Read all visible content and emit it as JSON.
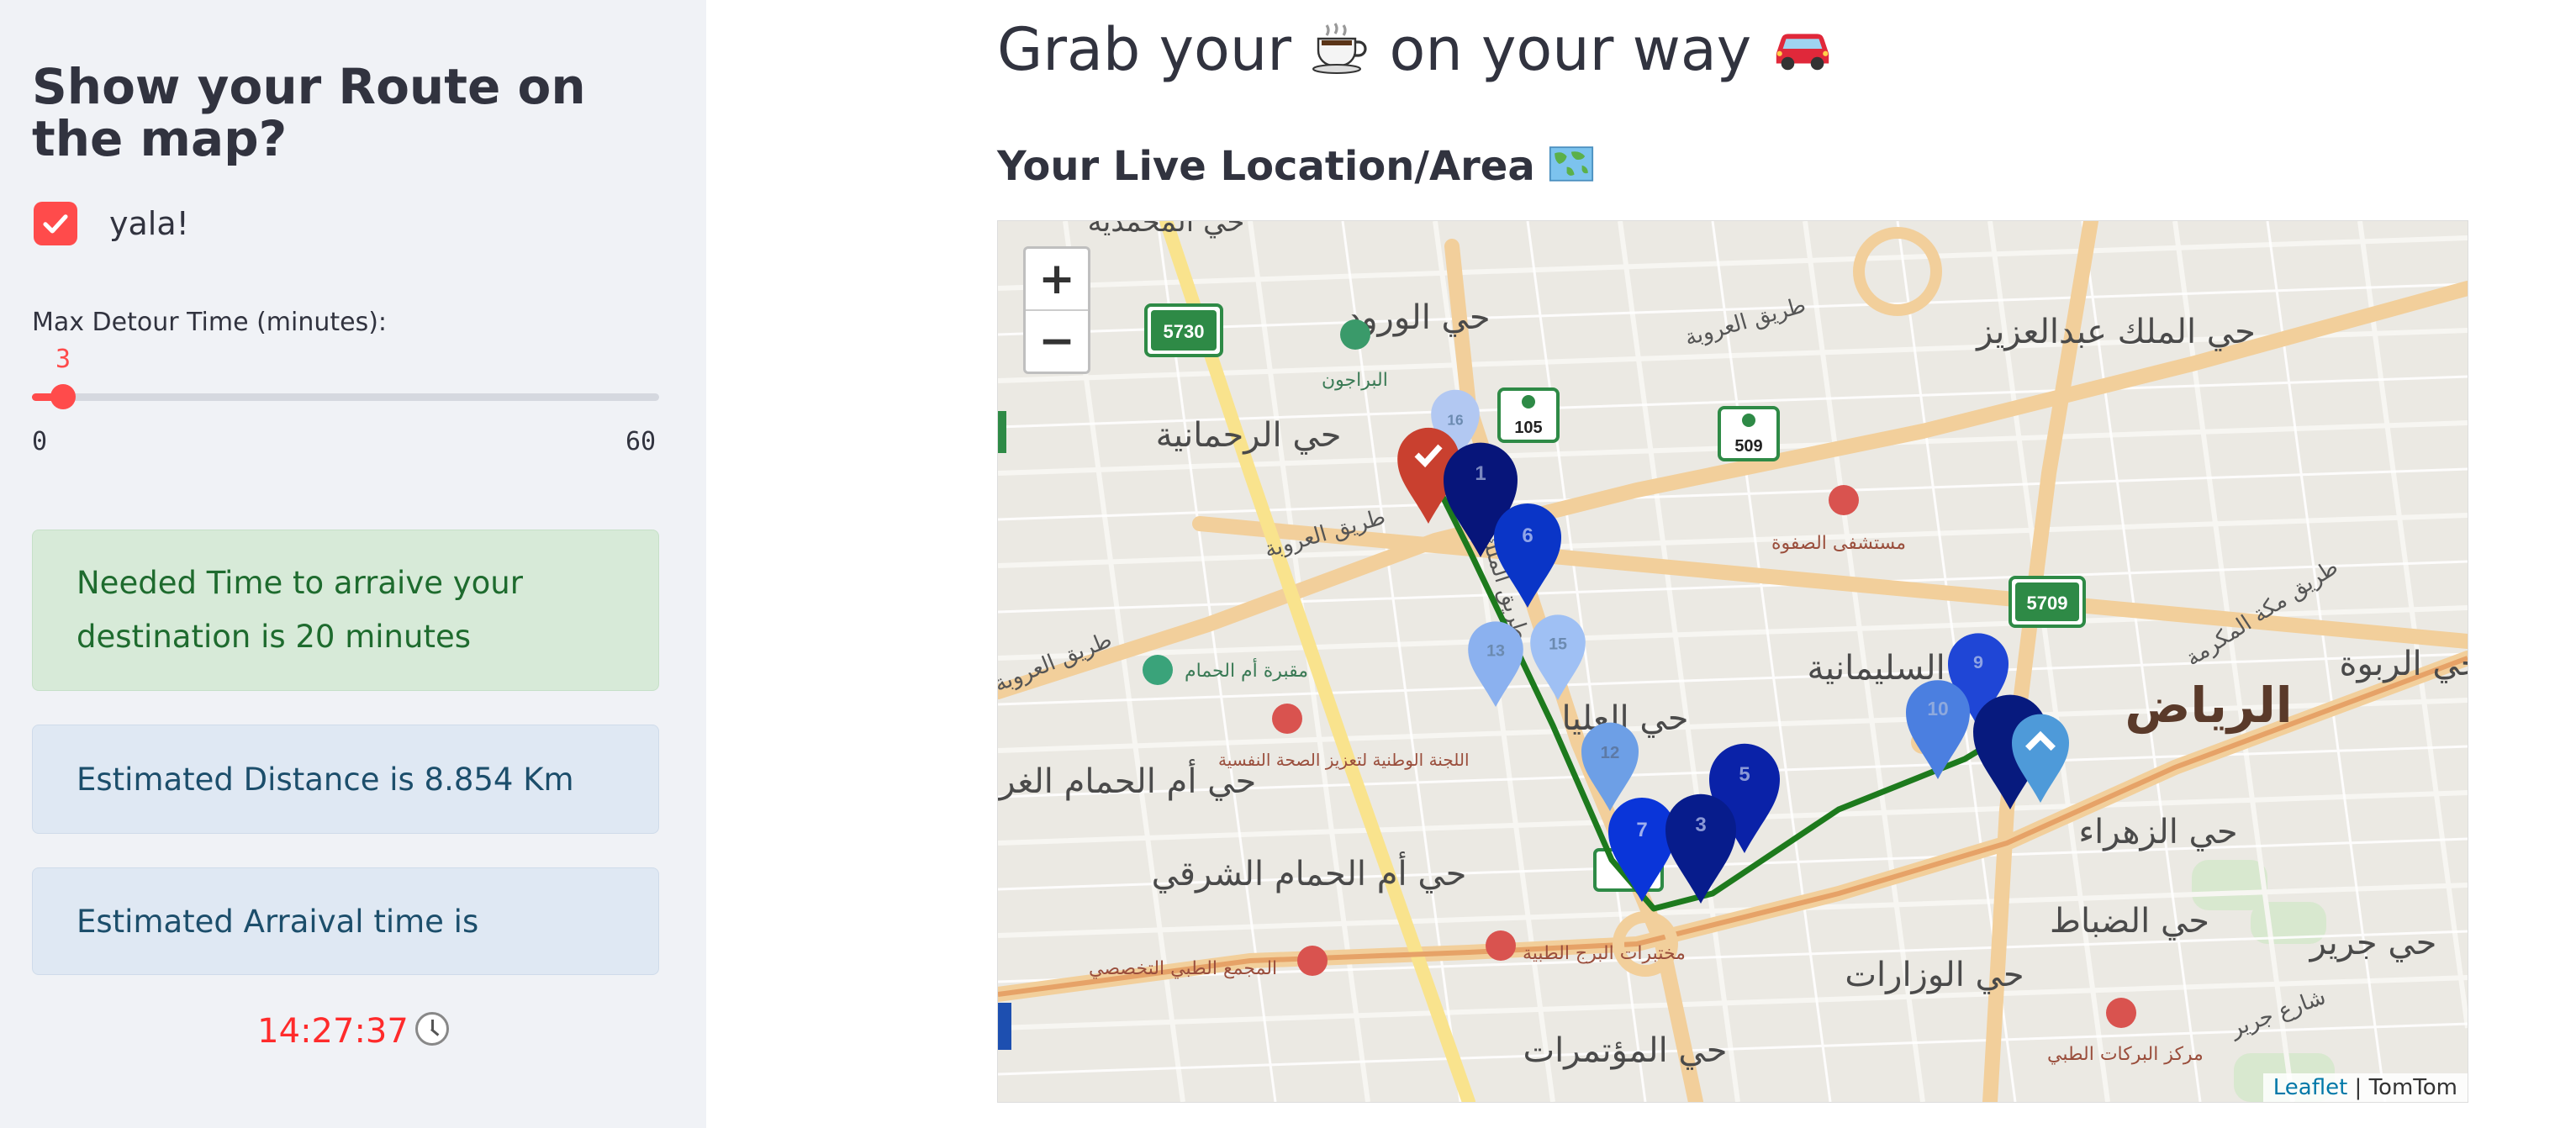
{
  "sidebar": {
    "title": "Show your Route on the map?",
    "checkbox_label": "yala!",
    "checkbox_checked": true,
    "slider": {
      "label": "Max Detour Time (minutes):",
      "value": 3,
      "min": 0,
      "max": 60
    },
    "alerts": {
      "needed_time": "Needed Time to arraive your destination is 20 minutes",
      "distance": "Estimated Distance is 8.854 Km",
      "arrival": "Estimated Arraival time is"
    },
    "eta": "14:27:37"
  },
  "main": {
    "title_part1": "Grab your",
    "title_part2": "on your way",
    "subtitle": "Your Live Location/Area"
  },
  "map": {
    "zoom_in": "+",
    "zoom_out": "−",
    "attribution_link": "Leaflet",
    "attribution_sep": " | ",
    "attribution_provider": "TomTom",
    "road_shields": [
      "5730",
      "105",
      "509",
      "5709"
    ],
    "district_labels": [
      "حي الورود",
      "حي الرحمانية",
      "حي الملك عبدالعزيز",
      "حي السليمانية",
      "حي العليا",
      "حي أم الحمام الغربي",
      "حي أم الحمام الشرقي",
      "حي الزهراء",
      "حي الضباط",
      "حي الوزارات",
      "حي المؤتمرات",
      "حي الربوة",
      "حي جرير",
      "الرياض",
      "حي المحمدية"
    ],
    "road_labels": [
      "طريق العروبة",
      "طريق العروبة",
      "طريق مكة المكرمة",
      "شارع جرير",
      "طريق العروبة",
      "طريق الملك فهد"
    ],
    "poi_labels": [
      "البراجون",
      "مستشفى الصفوة",
      "مقبرة أم الحمام",
      "اللجنة الوطنية لتعزيز الصحة النفسية",
      "مختبرات البرج الطبية",
      "المجمع الطبي التخصصي",
      "مركز البركات الطبي"
    ],
    "marker_labels": [
      "16",
      "1",
      "6",
      "13",
      "15",
      "12",
      "9",
      "10",
      "7",
      "3",
      "5"
    ]
  }
}
